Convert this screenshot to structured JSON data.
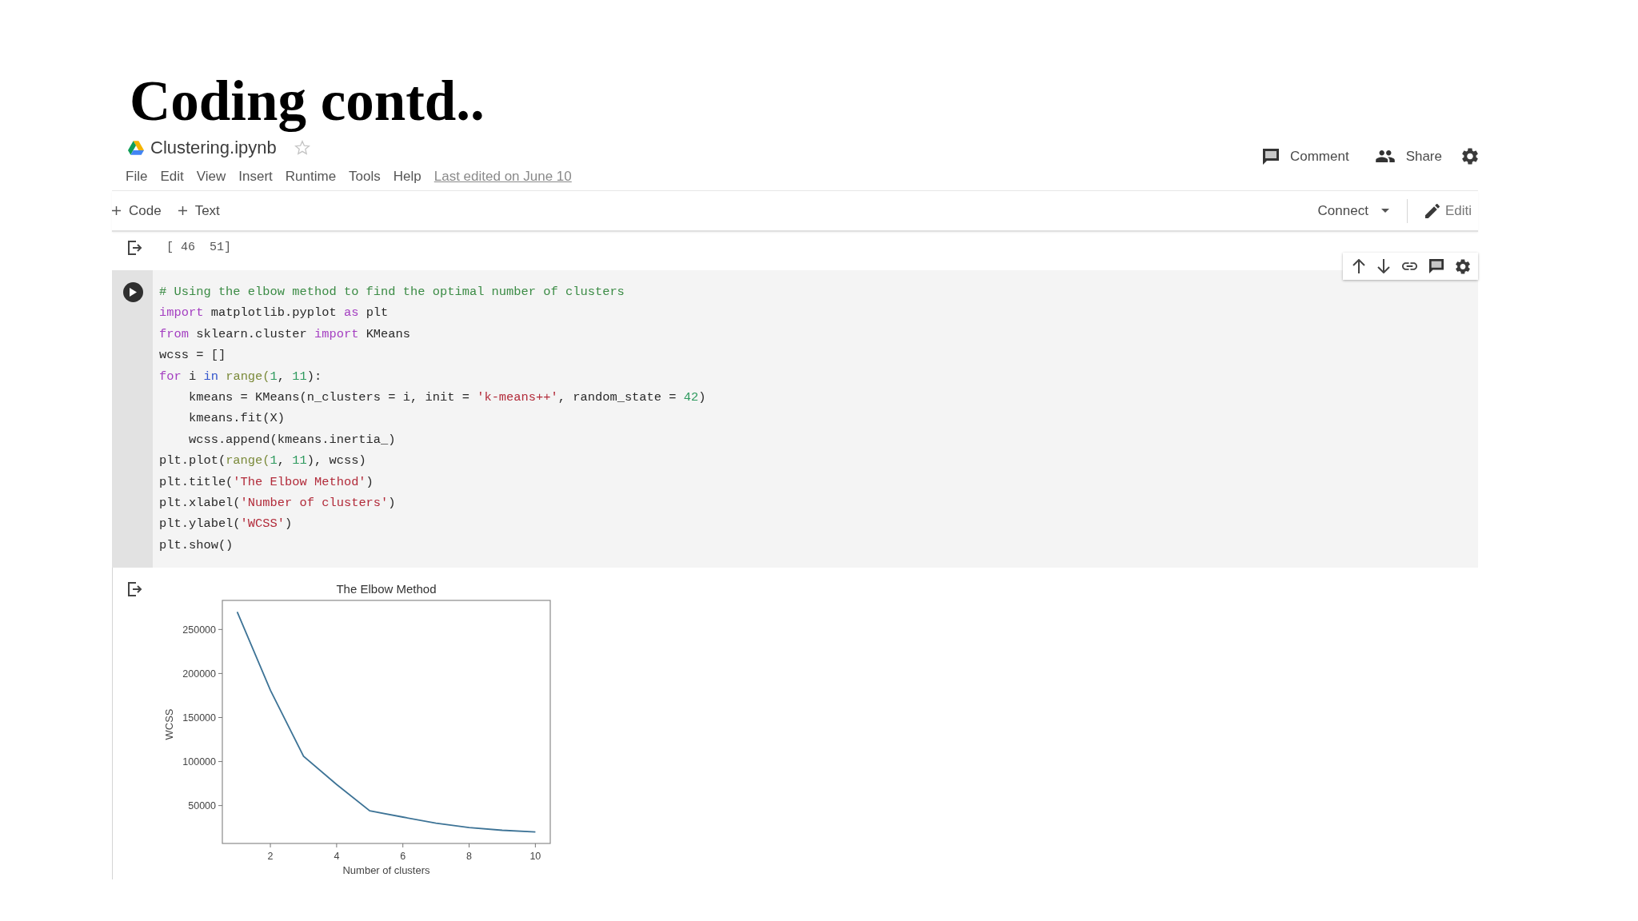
{
  "slide_title": "Coding contd..",
  "notebook": {
    "file_name": "Clustering.ipynb",
    "menu": [
      "File",
      "Edit",
      "View",
      "Insert",
      "Runtime",
      "Tools",
      "Help"
    ],
    "last_edited": "Last edited on June 10",
    "header_actions": [
      {
        "kind": "comment",
        "label": "Comment"
      },
      {
        "kind": "share",
        "label": "Share"
      }
    ],
    "toolbar": {
      "add_buttons": [
        "Code",
        "Text"
      ],
      "connect": "Connect",
      "mode": "Editi"
    },
    "cells": [
      {
        "kind": "output",
        "text": "[ 46  51]"
      },
      {
        "kind": "code",
        "lines": [
          [
            {
              "kind": "comment",
              "text": "# Using the elbow method to find the optimal number of clusters"
            }
          ],
          [
            {
              "kind": "keyword",
              "text": "import"
            },
            {
              "kind": "plain",
              "text": " matplotlib.pyplot "
            },
            {
              "kind": "keyword",
              "text": "as"
            },
            {
              "kind": "plain",
              "text": " plt"
            }
          ],
          [
            {
              "kind": "keyword",
              "text": "from"
            },
            {
              "kind": "plain",
              "text": " sklearn.cluster "
            },
            {
              "kind": "keyword",
              "text": "import"
            },
            {
              "kind": "plain",
              "text": " KMeans"
            }
          ],
          [
            {
              "kind": "plain",
              "text": "wcss = []"
            }
          ],
          [
            {
              "kind": "keyword",
              "text": "for"
            },
            {
              "kind": "plain",
              "text": " i "
            },
            {
              "kind": "operator",
              "text": "in"
            },
            {
              "kind": "builtin",
              "text": " range("
            },
            {
              "kind": "number",
              "text": "1"
            },
            {
              "kind": "plain",
              "text": ", "
            },
            {
              "kind": "number",
              "text": "11"
            },
            {
              "kind": "plain",
              "text": "):"
            }
          ],
          [
            {
              "kind": "plain",
              "text": "    kmeans = KMeans(n_clusters = i, init = "
            },
            {
              "kind": "string",
              "text": "'k-means++'"
            },
            {
              "kind": "plain",
              "text": ", random_state = "
            },
            {
              "kind": "number",
              "text": "42"
            },
            {
              "kind": "plain",
              "text": ")"
            }
          ],
          [
            {
              "kind": "plain",
              "text": "    kmeans.fit(X)"
            }
          ],
          [
            {
              "kind": "plain",
              "text": "    wcss.append(kmeans.inertia_)"
            }
          ],
          [
            {
              "kind": "plain",
              "text": "plt.plot("
            },
            {
              "kind": "builtin",
              "text": "range("
            },
            {
              "kind": "number",
              "text": "1"
            },
            {
              "kind": "plain",
              "text": ", "
            },
            {
              "kind": "number",
              "text": "11"
            },
            {
              "kind": "plain",
              "text": "), wcss)"
            }
          ],
          [
            {
              "kind": "plain",
              "text": "plt.title("
            },
            {
              "kind": "string",
              "text": "'The Elbow Method'"
            },
            {
              "kind": "plain",
              "text": ")"
            }
          ],
          [
            {
              "kind": "plain",
              "text": "plt.xlabel("
            },
            {
              "kind": "string",
              "text": "'Number of clusters'"
            },
            {
              "kind": "plain",
              "text": ")"
            }
          ],
          [
            {
              "kind": "plain",
              "text": "plt.ylabel("
            },
            {
              "kind": "string",
              "text": "'WCSS'"
            },
            {
              "kind": "plain",
              "text": ")"
            }
          ],
          [
            {
              "kind": "plain",
              "text": "plt.show()"
            }
          ]
        ]
      },
      {
        "kind": "plot_output",
        "chart_data": [
          {
            "type": "line",
            "title": "The Elbow Method",
            "xlabel": "Number of clusters",
            "ylabel": "WCSS",
            "x": [
              1,
              2,
              3,
              4,
              5,
              6,
              7,
              8,
              9,
              10
            ],
            "values": [
              270000,
              181000,
              106000,
              74000,
              44000,
              37000,
              30000,
              25000,
              22000,
              20000
            ],
            "color": "#3d7396",
            "xlim": [
              0.55,
              10.45
            ],
            "ylim": [
              7000,
              283000
            ],
            "xticks": [
              2,
              4,
              6,
              8,
              10
            ],
            "yticks": [
              50000,
              100000,
              150000,
              200000,
              250000
            ]
          }
        ]
      }
    ]
  }
}
